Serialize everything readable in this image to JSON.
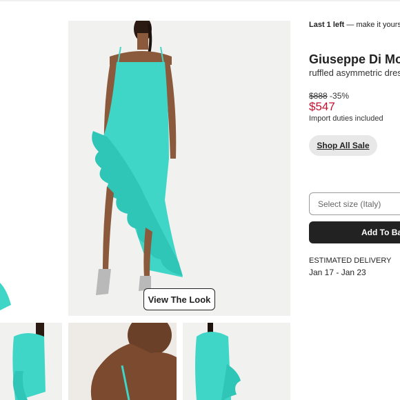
{
  "stock": {
    "bold": "Last 1 left",
    "rest": "— make it yours!"
  },
  "product": {
    "brand": "Giuseppe Di Mora",
    "description": "ruffled asymmetric dress"
  },
  "price": {
    "original": "$888",
    "discount": "-35%",
    "sale": "$547",
    "duties_note": "Import duties included"
  },
  "buttons": {
    "shop_all_sale": "Shop All Sale",
    "view_the_look": "View The Look",
    "add_to_bag": "Add To Bag"
  },
  "size_select": {
    "placeholder": "Select size (Italy)"
  },
  "delivery": {
    "label": "ESTIMATED DELIVERY",
    "dates": "Jan 17 - Jan 23"
  },
  "colors": {
    "dress": "#3fd6c8",
    "sale_price": "#c0102e",
    "background_photo": "#f1f1ef",
    "button_dark": "#222222"
  }
}
